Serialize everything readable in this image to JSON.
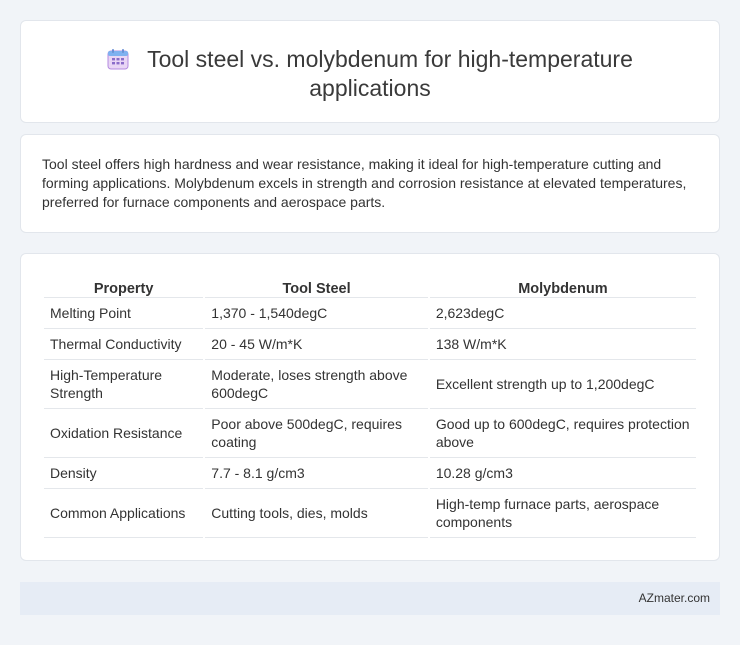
{
  "header": {
    "title": "Tool steel vs. molybdenum for high-temperature applications",
    "icon": "calendar-icon"
  },
  "description": {
    "text": "Tool steel offers high hardness and wear resistance, making it ideal for high-temperature cutting and forming applications. Molybdenum excels in strength and corrosion resistance at elevated temperatures, preferred for furnace components and aerospace parts."
  },
  "table": {
    "headers": [
      "Property",
      "Tool Steel",
      "Molybdenum"
    ],
    "rows": [
      [
        "Melting Point",
        "1,370 - 1,540degC",
        "2,623degC"
      ],
      [
        "Thermal Conductivity",
        "20 - 45 W/m*K",
        "138 W/m*K"
      ],
      [
        "High-Temperature Strength",
        "Moderate, loses strength above 600degC",
        "Excellent strength up to 1,200degC"
      ],
      [
        "Oxidation Resistance",
        "Poor above 500degC, requires coating",
        "Good up to 600degC, requires protection above"
      ],
      [
        "Density",
        "7.7 - 8.1 g/cm3",
        "10.28 g/cm3"
      ],
      [
        "Common Applications",
        "Cutting tools, dies, molds",
        "High-temp furnace parts, aerospace components"
      ]
    ]
  },
  "footer": {
    "brand": "AZmater.com"
  }
}
